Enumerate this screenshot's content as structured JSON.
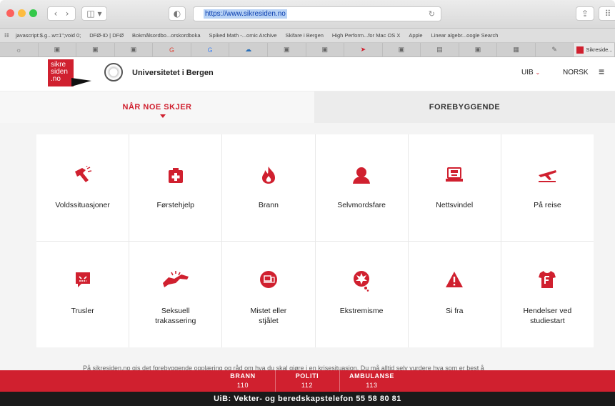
{
  "browser": {
    "url": "https://www.sikresiden.no",
    "bookmarks": [
      "javascript:$.g...w=1\";void 0;",
      "DFØ-ID | DFØ",
      "Bokmålsordbo...orskordboka",
      "Spiked Math -...omic Archive",
      "Skifare i Bergen",
      "High Perform...for Mac OS X",
      "Apple",
      "Linear algebr...oogle Search"
    ],
    "active_tab_title": "Sikreside..."
  },
  "site": {
    "logo_lines": [
      "sikre",
      "siden",
      ".no"
    ],
    "university": "Universitetet i Bergen",
    "uib": "UIB",
    "language": "NORSK"
  },
  "nav": {
    "active": "NÅR NOE SKJER",
    "inactive": "FOREBYGGENDE"
  },
  "tiles": [
    {
      "label": "Voldssituasjoner",
      "icon": "hand-violence-icon"
    },
    {
      "label": "Førstehjelp",
      "icon": "first-aid-icon"
    },
    {
      "label": "Brann",
      "icon": "fire-icon"
    },
    {
      "label": "Selvmordsfare",
      "icon": "person-icon"
    },
    {
      "label": "Nettsvindel",
      "icon": "hacker-laptop-icon"
    },
    {
      "label": "På reise",
      "icon": "airplane-icon"
    },
    {
      "label": "Trusler",
      "icon": "threat-speech-icon"
    },
    {
      "label": "Seksuell trakassering",
      "icon": "harassment-hand-icon"
    },
    {
      "label": "Mistet eller stjålet",
      "icon": "devices-icon"
    },
    {
      "label": "Ekstremisme",
      "icon": "explosion-icon"
    },
    {
      "label": "Si fra",
      "icon": "warning-icon"
    },
    {
      "label": "Hendelser ved studiestart",
      "icon": "tshirt-icon"
    }
  ],
  "intro_text": "På sikresiden.no gis det forebyggende opplæring og råd om hva du skal gjøre i en krisesituasjon. Du må alltid selv vurdere hva som er best å",
  "emergency": [
    {
      "label": "BRANN",
      "number": "110"
    },
    {
      "label": "POLITI",
      "number": "112"
    },
    {
      "label": "AMBULANSE",
      "number": "113"
    }
  ],
  "vekter": "UiB: Vekter- og beredskapstelefon 55 58 80 81"
}
